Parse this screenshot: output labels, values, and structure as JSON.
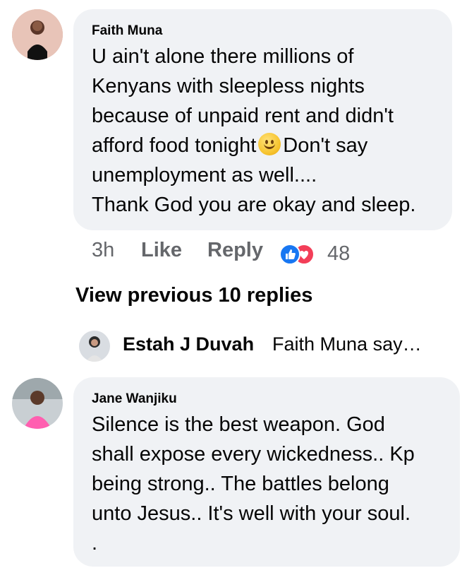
{
  "comment1": {
    "author": "Faith Muna",
    "lines": [
      "U ain't alone there millions  of",
      "Kenyans with sleepless nights",
      "because of unpaid rent and didn't",
      "afford food tonight",
      "Don't say",
      "unemployment as well....",
      "Thank God you are okay and sleep."
    ],
    "emoji": "slightly-smiling-face",
    "time": "3h",
    "like_label": "Like",
    "reply_label": "Reply",
    "reaction_icons": [
      "like-icon",
      "love-icon"
    ],
    "reaction_count": "48"
  },
  "view_previous": "View previous 10 replies",
  "reply_preview": {
    "author": "Estah J Duvah",
    "snippet": "Faith Muna say…"
  },
  "comment2": {
    "author": "Jane Wanjiku",
    "lines": [
      "Silence is the best weapon. God",
      "shall expose every wickedness.. Kp",
      "being strong.. The battles belong",
      "unto Jesus.. It's well with your soul.",
      "."
    ]
  },
  "colors": {
    "bubble": "#f0f2f5",
    "meta_text": "#65676b",
    "like_blue": "#1877f2",
    "love_red": "#f33e58"
  }
}
